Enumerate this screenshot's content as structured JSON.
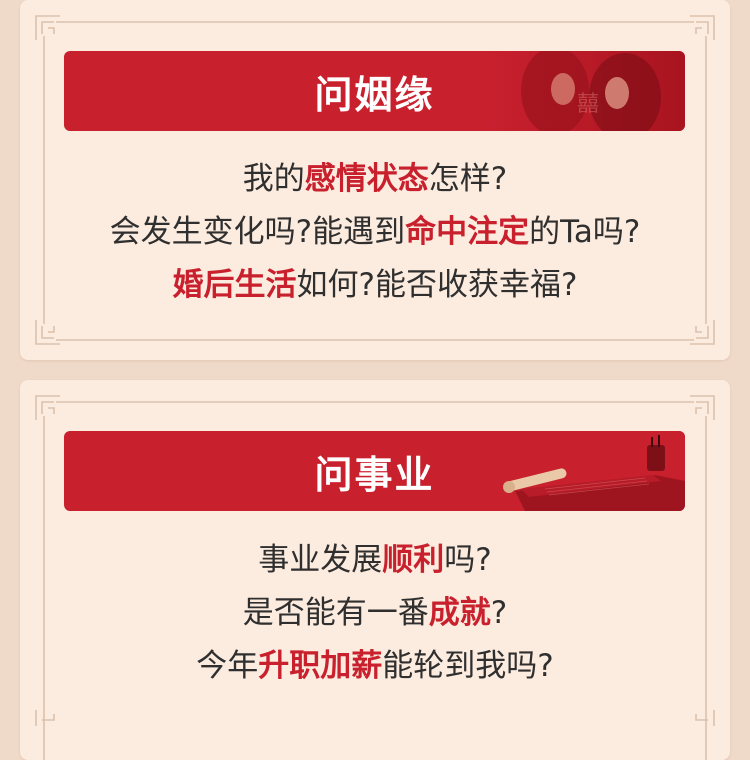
{
  "cards": [
    {
      "title": "问姻缘",
      "lines": [
        [
          "我的",
          {
            "hl": "感情状态"
          },
          "怎样?"
        ],
        [
          "会发生变化吗?能遇到",
          {
            "hl": "命中注定"
          },
          "的Ta吗?"
        ],
        [
          {
            "hl": "婚后生活"
          },
          "如何?能否收获幸福?"
        ]
      ]
    },
    {
      "title": "问事业",
      "lines": [
        [
          "事业发展",
          {
            "hl": "顺利"
          },
          "吗?"
        ],
        [
          "是否能有一番",
          {
            "hl": "成就"
          },
          "?"
        ],
        [
          "今年",
          {
            "hl": "升职加薪"
          },
          "能轮到我吗?"
        ]
      ]
    }
  ],
  "colors": {
    "page_bg": "#efd9c8",
    "card_bg": "#fcebdf",
    "banner_red": "#c9202e",
    "highlight_red": "#c9202e",
    "text": "#2f2f2f",
    "frame": "#dcc2ad"
  },
  "icons": [
    "couple-illustration",
    "scroll-desk-illustration",
    "corner-fret-ornament"
  ]
}
